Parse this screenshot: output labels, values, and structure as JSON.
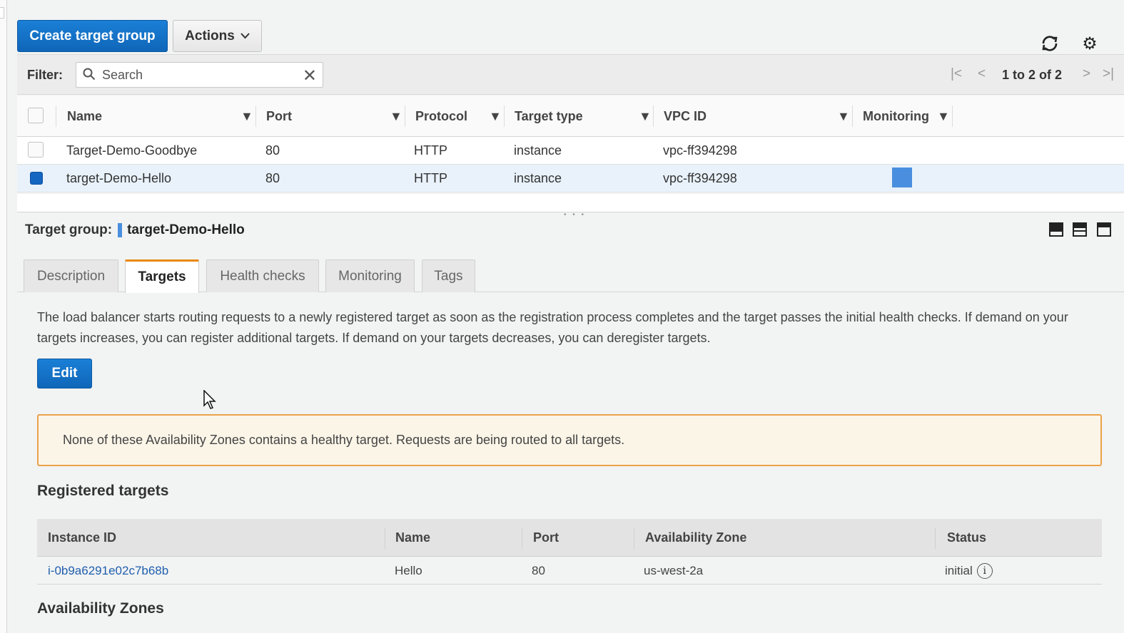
{
  "toolbar": {
    "create_label": "Create target group",
    "actions_label": "Actions"
  },
  "filter": {
    "label": "Filter:",
    "search_placeholder": "Search",
    "pagination": "1 to 2 of 2"
  },
  "grid": {
    "columns": [
      "Name",
      "Port",
      "Protocol",
      "Target type",
      "VPC ID",
      "Monitoring"
    ],
    "rows": [
      {
        "name": "Target-Demo-Goodbye",
        "port": "80",
        "protocol": "HTTP",
        "target_type": "instance",
        "vpc": "vpc-ff394298",
        "selected": false
      },
      {
        "name": "target-Demo-Hello",
        "port": "80",
        "protocol": "HTTP",
        "target_type": "instance",
        "vpc": "vpc-ff394298",
        "selected": true
      }
    ]
  },
  "detail": {
    "label": "Target group:",
    "name": "target-Demo-Hello",
    "tabs": [
      "Description",
      "Targets",
      "Health checks",
      "Monitoring",
      "Tags"
    ],
    "active_tab": "Targets",
    "description": "The load balancer starts routing requests to a newly registered target as soon as the registration process completes and the target passes the initial health checks. If demand on your targets increases, you can register additional targets. If demand on your targets decreases, you can deregister targets.",
    "edit_label": "Edit",
    "warning": "None of these Availability Zones contains a healthy target. Requests are being routed to all targets.",
    "registered_heading": "Registered targets",
    "registered_columns": [
      "Instance ID",
      "Name",
      "Port",
      "Availability Zone",
      "Status"
    ],
    "registered_rows": [
      {
        "instance_id": "i-0b9a6291e02c7b68b",
        "name": "Hello",
        "port": "80",
        "az": "us-west-2a",
        "status": "initial"
      }
    ],
    "az_heading": "Availability Zones"
  },
  "colors": {
    "primary": "#1566c0",
    "active_tab_accent": "#e8890c",
    "warning_border": "#eba24a",
    "warning_bg": "#fbf5e8",
    "link": "#1f5fad"
  }
}
